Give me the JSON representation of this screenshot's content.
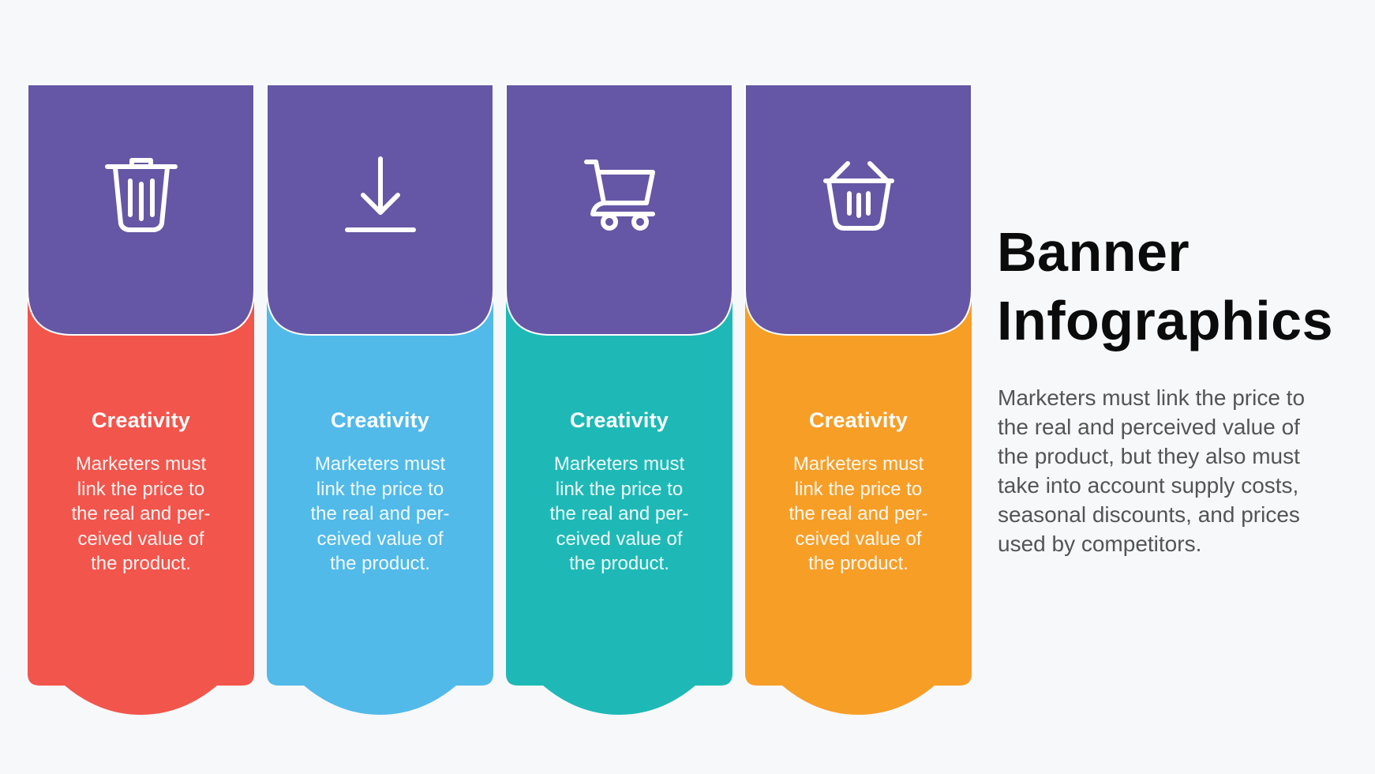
{
  "colors": {
    "background": "#f7f8fa",
    "header": "#6557a5",
    "cards": [
      "#f2554c",
      "#51bae9",
      "#1eb9b6",
      "#f79e27"
    ]
  },
  "cards": [
    {
      "icon": "trash-icon",
      "title": "Creativity",
      "body": "Marketers must\nlink the price to\nthe real and per-\nceived value of\nthe product."
    },
    {
      "icon": "download-icon",
      "title": "Creativity",
      "body": "Marketers must\nlink the price to\nthe real and per-\nceived value of\nthe product."
    },
    {
      "icon": "shopping-cart-icon",
      "title": "Creativity",
      "body": "Marketers must\nlink the price to\nthe real and per-\nceived value of\nthe product."
    },
    {
      "icon": "shopping-basket-icon",
      "title": "Creativity",
      "body": "Marketers must\nlink the price to\nthe real and per-\nceived value of\nthe product."
    }
  ],
  "side": {
    "title": "Banner\nInfographics",
    "description": "Marketers must link the price to\nthe real and perceived value of\nthe product, but they also must\ntake into account supply costs,\nseasonal discounts, and prices\nused by competitors."
  }
}
